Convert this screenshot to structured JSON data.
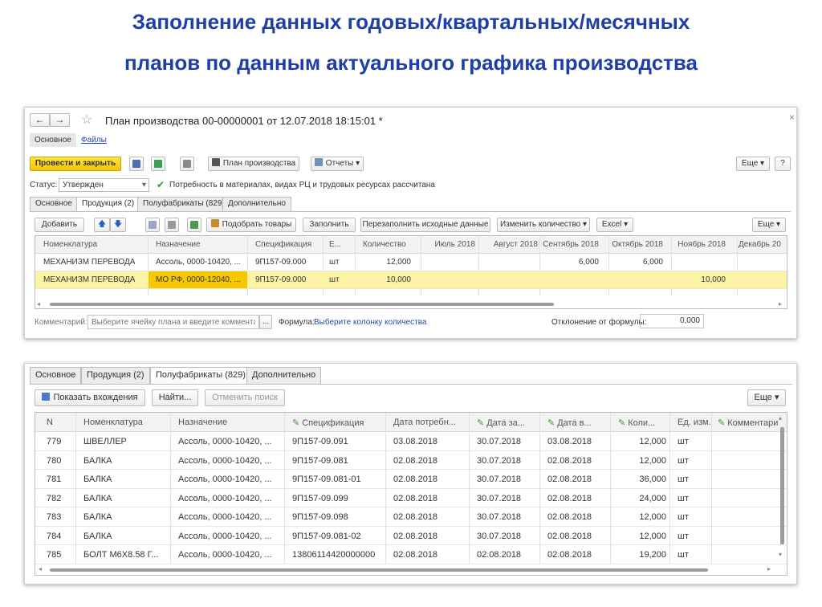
{
  "page": {
    "title_line1": "Заполнение данных годовых/квартальных/месячных",
    "title_line2": "планов по данным актуального графика производства"
  },
  "form1": {
    "nav_back": "←",
    "nav_forward": "→",
    "star": "☆",
    "doc_title": "План производства 00-00000001 от 12.07.2018 18:15:01 *",
    "close": "×",
    "top_tabs": [
      "Основное",
      "Файлы"
    ],
    "toolbar": {
      "post_close": "Провести и закрыть",
      "plan_print": "План производства",
      "reports": "Отчеты",
      "more": "Еще",
      "help": "?"
    },
    "status_label": "Статус:",
    "status_value": "Утвержден",
    "status_note": "Потребность в материалах, видах РЦ и трудовых ресурсах рассчитана",
    "tabs": [
      "Основное",
      "Продукция (2)",
      "Полуфабрикаты (829)",
      "Дополнительно"
    ],
    "grid_toolbar": {
      "add": "Добавить",
      "pick": "Подобрать товары",
      "fill": "Заполнить",
      "refill": "Перезаполнить исходные данные",
      "change_qty": "Изменить количество",
      "excel": "Excel",
      "more": "Еще"
    },
    "columns": [
      "Номенклатура",
      "Назначение",
      "Спецификация",
      "Е...",
      "Количество",
      "Июль 2018",
      "Август 2018",
      "Сентябрь 2018",
      "Октябрь 2018",
      "Ноябрь 2018",
      "Декабрь 20"
    ],
    "rows": [
      {
        "nom": "МЕХАНИЗМ ПЕРЕВОДА",
        "purpose": "Ассоль, 0000-10420, ...",
        "spec": "9П157-09.000",
        "unit": "шт",
        "qty": "12,000",
        "jul": "",
        "aug": "",
        "sep": "6,000",
        "oct": "6,000",
        "nov": "",
        "dec": ""
      },
      {
        "nom": "МЕХАНИЗМ ПЕРЕВОДА",
        "purpose": "МО РФ, 0000-12040, ...",
        "spec": "9П157-09.000",
        "unit": "шт",
        "qty": "10,000",
        "jul": "",
        "aug": "",
        "sep": "",
        "oct": "",
        "nov": "10,000",
        "dec": ""
      }
    ],
    "comment_label": "Комментарий:",
    "comment_placeholder": "Выберите ячейку плана и введите комментарий",
    "comment_btn": "...",
    "formula_label": "Формула:",
    "formula_link": "Выберите колонку количества",
    "deviation_label": "Отклонение от формулы:",
    "deviation_value": "0,000"
  },
  "form2": {
    "tabs": [
      "Основное",
      "Продукция (2)",
      "Полуфабрикаты (829)",
      "Дополнительно"
    ],
    "toolbar": {
      "show_entries": "Показать вхождения",
      "find": "Найти...",
      "cancel_search": "Отменить поиск",
      "more": "Еще"
    },
    "columns": [
      "N",
      "Номенклатура",
      "Назначение",
      "Спецификация",
      "Дата потребн...",
      "Дата за...",
      "Дата в...",
      "Коли...",
      "Ед. изм.",
      "Комментари"
    ],
    "rows": [
      {
        "n": "779",
        "nom": "ШВЕЛЛЕР",
        "purpose": "Ассоль, 0000-10420, ...",
        "spec": "9П157-09.091",
        "d1": "03.08.2018",
        "d2": "30.07.2018",
        "d3": "03.08.2018",
        "qty": "12,000",
        "unit": "шт"
      },
      {
        "n": "780",
        "nom": "БАЛКА",
        "purpose": "Ассоль, 0000-10420, ...",
        "spec": "9П157-09.081",
        "d1": "02.08.2018",
        "d2": "30.07.2018",
        "d3": "02.08.2018",
        "qty": "12,000",
        "unit": "шт"
      },
      {
        "n": "781",
        "nom": "БАЛКА",
        "purpose": "Ассоль, 0000-10420, ...",
        "spec": "9П157-09.081-01",
        "d1": "02.08.2018",
        "d2": "30.07.2018",
        "d3": "02.08.2018",
        "qty": "36,000",
        "unit": "шт"
      },
      {
        "n": "782",
        "nom": "БАЛКА",
        "purpose": "Ассоль, 0000-10420, ...",
        "spec": "9П157-09.099",
        "d1": "02.08.2018",
        "d2": "30.07.2018",
        "d3": "02.08.2018",
        "qty": "24,000",
        "unit": "шт"
      },
      {
        "n": "783",
        "nom": "БАЛКА",
        "purpose": "Ассоль, 0000-10420, ...",
        "spec": "9П157-09.098",
        "d1": "02.08.2018",
        "d2": "30.07.2018",
        "d3": "02.08.2018",
        "qty": "12,000",
        "unit": "шт"
      },
      {
        "n": "784",
        "nom": "БАЛКА",
        "purpose": "Ассоль, 0000-10420, ...",
        "spec": "9П157-09.081-02",
        "d1": "02.08.2018",
        "d2": "30.07.2018",
        "d3": "02.08.2018",
        "qty": "12,000",
        "unit": "шт"
      },
      {
        "n": "785",
        "nom": "БОЛТ М6Х8.58 Г...",
        "purpose": "Ассоль, 0000-10420, ...",
        "spec": "13806114420000000",
        "d1": "02.08.2018",
        "d2": "02.08.2018",
        "d3": "02.08.2018",
        "qty": "19,200",
        "unit": "шт"
      }
    ]
  }
}
